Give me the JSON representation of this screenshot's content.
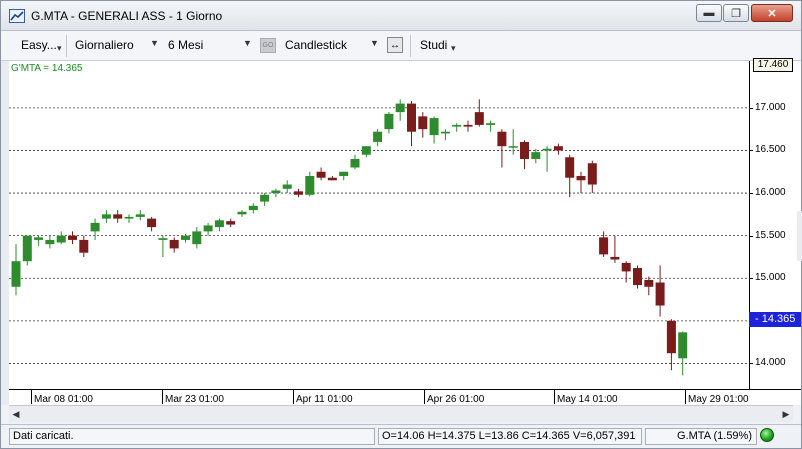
{
  "window": {
    "title": "G.MTA - GENERALI ASS - 1 Giorno"
  },
  "toolbar": {
    "mode_label": "Easy...",
    "interval_label": "Giornaliero",
    "range_label": "6 Mesi",
    "go_label": "GO",
    "chart_type_label": "Candlestick",
    "studies_label": "Studi"
  },
  "legend": {
    "text": "G'MTA = 14.365"
  },
  "price_axis": {
    "top_value": "17.460",
    "last_value": "- 14.365",
    "ticks": [
      "17.000",
      "16.500",
      "16.000",
      "15.500",
      "15.000",
      "14.500",
      "14.000"
    ]
  },
  "date_axis": {
    "ticks": [
      "Mar 08 01:00",
      "Mar 23 01:00",
      "Apr 11 01:00",
      "Apr 26 01:00",
      "May 14 01:00",
      "May 29 01:00"
    ]
  },
  "status": {
    "message": "Dati caricati.",
    "quote": "O=14.06  H=14.375  L=13.86  C=14.365  V=6,057,391",
    "symbol": "G.MTA (1.59%)"
  },
  "colors": {
    "up": "#2e8b2e",
    "down": "#7a1c1c",
    "last_price_bg": "#1d23d8"
  },
  "chart_data": {
    "type": "candlestick",
    "y_range": [
      13.7,
      17.55
    ],
    "gridlines": [
      17.0,
      16.5,
      16.0,
      15.5,
      15.0,
      14.5,
      14.0
    ],
    "candles": [
      {
        "o": 14.9,
        "h": 15.4,
        "l": 14.8,
        "c": 15.2
      },
      {
        "o": 15.2,
        "h": 15.5,
        "l": 15.15,
        "c": 15.5
      },
      {
        "o": 15.45,
        "h": 15.5,
        "l": 15.38,
        "c": 15.48
      },
      {
        "o": 15.4,
        "h": 15.5,
        "l": 15.35,
        "c": 15.45
      },
      {
        "o": 15.42,
        "h": 15.55,
        "l": 15.4,
        "c": 15.5
      },
      {
        "o": 15.5,
        "h": 15.55,
        "l": 15.4,
        "c": 15.45
      },
      {
        "o": 15.45,
        "h": 15.5,
        "l": 15.25,
        "c": 15.3
      },
      {
        "o": 15.55,
        "h": 15.7,
        "l": 15.45,
        "c": 15.65
      },
      {
        "o": 15.7,
        "h": 15.8,
        "l": 15.65,
        "c": 15.75
      },
      {
        "o": 15.75,
        "h": 15.8,
        "l": 15.65,
        "c": 15.7
      },
      {
        "o": 15.7,
        "h": 15.75,
        "l": 15.65,
        "c": 15.72
      },
      {
        "o": 15.72,
        "h": 15.8,
        "l": 15.68,
        "c": 15.75
      },
      {
        "o": 15.7,
        "h": 15.72,
        "l": 15.55,
        "c": 15.6
      },
      {
        "o": 15.45,
        "h": 15.5,
        "l": 15.25,
        "c": 15.47
      },
      {
        "o": 15.45,
        "h": 15.48,
        "l": 15.3,
        "c": 15.35
      },
      {
        "o": 15.45,
        "h": 15.52,
        "l": 15.42,
        "c": 15.5
      },
      {
        "o": 15.4,
        "h": 15.6,
        "l": 15.35,
        "c": 15.55
      },
      {
        "o": 15.55,
        "h": 15.65,
        "l": 15.5,
        "c": 15.62
      },
      {
        "o": 15.6,
        "h": 15.7,
        "l": 15.55,
        "c": 15.68
      },
      {
        "o": 15.67,
        "h": 15.7,
        "l": 15.6,
        "c": 15.63
      },
      {
        "o": 15.75,
        "h": 15.8,
        "l": 15.72,
        "c": 15.78
      },
      {
        "o": 15.8,
        "h": 15.88,
        "l": 15.76,
        "c": 15.85
      },
      {
        "o": 15.9,
        "h": 16.0,
        "l": 15.85,
        "c": 15.98
      },
      {
        "o": 16.0,
        "h": 16.05,
        "l": 15.95,
        "c": 16.03
      },
      {
        "o": 16.05,
        "h": 16.15,
        "l": 16.0,
        "c": 16.1
      },
      {
        "o": 16.02,
        "h": 16.05,
        "l": 15.95,
        "c": 15.98
      },
      {
        "o": 15.98,
        "h": 16.25,
        "l": 15.96,
        "c": 16.2
      },
      {
        "o": 16.25,
        "h": 16.3,
        "l": 16.15,
        "c": 16.18
      },
      {
        "o": 16.18,
        "h": 16.2,
        "l": 16.15,
        "c": 16.15
      },
      {
        "o": 16.2,
        "h": 16.25,
        "l": 16.15,
        "c": 16.25
      },
      {
        "o": 16.3,
        "h": 16.45,
        "l": 16.28,
        "c": 16.4
      },
      {
        "o": 16.45,
        "h": 16.55,
        "l": 16.42,
        "c": 16.55
      },
      {
        "o": 16.6,
        "h": 16.75,
        "l": 16.55,
        "c": 16.72
      },
      {
        "o": 16.75,
        "h": 16.95,
        "l": 16.7,
        "c": 16.93
      },
      {
        "o": 16.95,
        "h": 17.1,
        "l": 16.85,
        "c": 17.05
      },
      {
        "o": 17.05,
        "h": 17.08,
        "l": 16.55,
        "c": 16.72
      },
      {
        "o": 16.9,
        "h": 16.95,
        "l": 16.65,
        "c": 16.75
      },
      {
        "o": 16.68,
        "h": 16.9,
        "l": 16.58,
        "c": 16.88
      },
      {
        "o": 16.7,
        "h": 16.75,
        "l": 16.62,
        "c": 16.72
      },
      {
        "o": 16.78,
        "h": 16.82,
        "l": 16.72,
        "c": 16.8
      },
      {
        "o": 16.8,
        "h": 16.85,
        "l": 16.72,
        "c": 16.78
      },
      {
        "o": 16.95,
        "h": 17.1,
        "l": 16.78,
        "c": 16.8
      },
      {
        "o": 16.8,
        "h": 16.85,
        "l": 16.72,
        "c": 16.82
      },
      {
        "o": 16.72,
        "h": 16.75,
        "l": 16.3,
        "c": 16.55
      },
      {
        "o": 16.55,
        "h": 16.75,
        "l": 16.45,
        "c": 16.55
      },
      {
        "o": 16.6,
        "h": 16.62,
        "l": 16.28,
        "c": 16.4
      },
      {
        "o": 16.4,
        "h": 16.52,
        "l": 16.35,
        "c": 16.48
      },
      {
        "o": 16.5,
        "h": 16.55,
        "l": 16.25,
        "c": 16.52
      },
      {
        "o": 16.55,
        "h": 16.58,
        "l": 16.45,
        "c": 16.5
      },
      {
        "o": 16.42,
        "h": 16.45,
        "l": 15.95,
        "c": 16.18
      },
      {
        "o": 16.2,
        "h": 16.25,
        "l": 16.0,
        "c": 16.15
      },
      {
        "o": 16.35,
        "h": 16.38,
        "l": 16.0,
        "c": 16.1
      },
      {
        "o": 15.48,
        "h": 15.55,
        "l": 15.25,
        "c": 15.28
      },
      {
        "o": 15.25,
        "h": 15.5,
        "l": 15.18,
        "c": 15.22
      },
      {
        "o": 15.18,
        "h": 15.2,
        "l": 14.95,
        "c": 15.08
      },
      {
        "o": 15.12,
        "h": 15.15,
        "l": 14.88,
        "c": 14.92
      },
      {
        "o": 14.98,
        "h": 15.02,
        "l": 14.8,
        "c": 14.9
      },
      {
        "o": 14.95,
        "h": 15.15,
        "l": 14.55,
        "c": 14.68
      },
      {
        "o": 14.5,
        "h": 14.52,
        "l": 13.92,
        "c": 14.12
      },
      {
        "o": 14.06,
        "h": 14.375,
        "l": 13.86,
        "c": 14.365
      }
    ]
  }
}
